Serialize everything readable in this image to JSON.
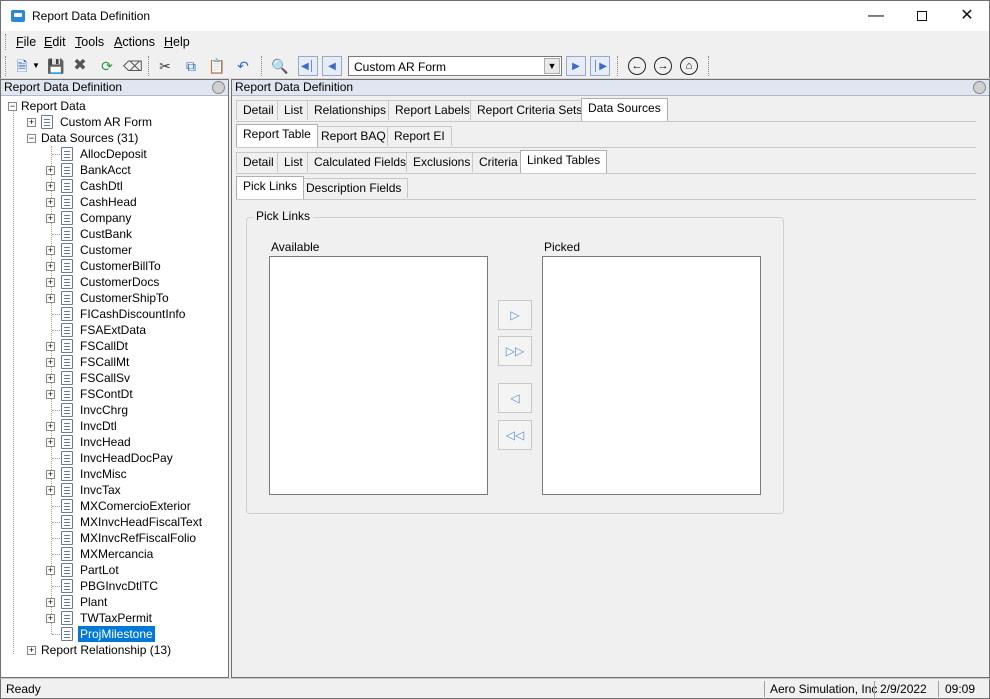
{
  "window": {
    "title": "Report Data Definition"
  },
  "menu": {
    "items": [
      {
        "key": "F",
        "rest": "ile"
      },
      {
        "key": "E",
        "rest": "dit"
      },
      {
        "key": "T",
        "rest": "ools"
      },
      {
        "key": "A",
        "rest": "ctions"
      },
      {
        "key": "H",
        "rest": "elp"
      }
    ]
  },
  "toolbar": {
    "record_value": "Custom AR Form"
  },
  "tree_panel": {
    "header": "Report Data Definition",
    "root": "Report Data",
    "custom_form": "Custom AR Form",
    "data_sources": "Data Sources (31)",
    "items": [
      {
        "label": "AllocDeposit",
        "expandable": false
      },
      {
        "label": "BankAcct",
        "expandable": true
      },
      {
        "label": "CashDtl",
        "expandable": true
      },
      {
        "label": "CashHead",
        "expandable": true
      },
      {
        "label": "Company",
        "expandable": true
      },
      {
        "label": "CustBank",
        "expandable": false
      },
      {
        "label": "Customer",
        "expandable": true
      },
      {
        "label": "CustomerBillTo",
        "expandable": true
      },
      {
        "label": "CustomerDocs",
        "expandable": true
      },
      {
        "label": "CustomerShipTo",
        "expandable": true
      },
      {
        "label": "FICashDiscountInfo",
        "expandable": false
      },
      {
        "label": "FSAExtData",
        "expandable": false
      },
      {
        "label": "FSCallDt",
        "expandable": true
      },
      {
        "label": "FSCallMt",
        "expandable": true
      },
      {
        "label": "FSCallSv",
        "expandable": true
      },
      {
        "label": "FSContDt",
        "expandable": true
      },
      {
        "label": "InvcChrg",
        "expandable": false
      },
      {
        "label": "InvcDtl",
        "expandable": true
      },
      {
        "label": "InvcHead",
        "expandable": true
      },
      {
        "label": "InvcHeadDocPay",
        "expandable": false
      },
      {
        "label": "InvcMisc",
        "expandable": true
      },
      {
        "label": "InvcTax",
        "expandable": true
      },
      {
        "label": "MXComercioExterior",
        "expandable": false
      },
      {
        "label": "MXInvcHeadFiscalText",
        "expandable": false
      },
      {
        "label": "MXInvcRefFiscalFolio",
        "expandable": false
      },
      {
        "label": "MXMercancia",
        "expandable": false
      },
      {
        "label": "PartLot",
        "expandable": true
      },
      {
        "label": "PBGInvcDtlTC",
        "expandable": false
      },
      {
        "label": "Plant",
        "expandable": true
      },
      {
        "label": "TWTaxPermit",
        "expandable": true
      },
      {
        "label": "ProjMilestone",
        "expandable": false,
        "selected": true
      }
    ],
    "report_relationship": "Report Relationship (13)"
  },
  "main_panel": {
    "header": "Report Data Definition",
    "tabs1": [
      "Detail",
      "List",
      "Relationships",
      "Report Labels",
      "Report Criteria Sets",
      "Data Sources"
    ],
    "tabs2": [
      "Report Table",
      "Report BAQ",
      "Report EI"
    ],
    "tabs3": [
      "Detail",
      "List",
      "Calculated Fields",
      "Exclusions",
      "Criteria",
      "Linked Tables"
    ],
    "tabs4": [
      "Pick Links",
      "Description Fields"
    ],
    "group_title": "Pick Links",
    "available_label": "Available",
    "picked_label": "Picked"
  },
  "status": {
    "state": "Ready",
    "company": "Aero Simulation, Inc",
    "date": "2/9/2022",
    "time": "09:09"
  }
}
